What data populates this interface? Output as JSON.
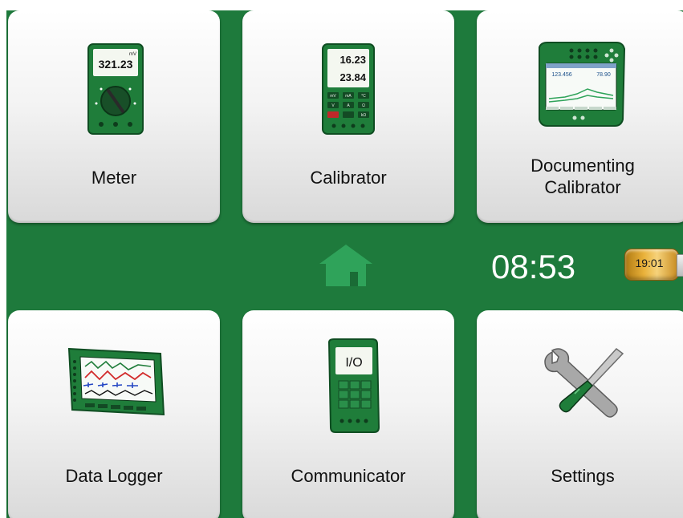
{
  "tiles": {
    "meter": {
      "label": "Meter",
      "display_value": "321.23",
      "display_unit": "mV"
    },
    "calibrator": {
      "label": "Calibrator",
      "display_top": "16.23",
      "display_bottom": "23.84",
      "unit_top": "mV",
      "unit_bottom": "mA",
      "keys": [
        "mV",
        "mA",
        "°C",
        "V",
        "A",
        "Ω",
        "kΩ"
      ]
    },
    "documenting_calibrator": {
      "label": "Documenting\nCalibrator",
      "value_left": "123.456",
      "value_right": "78.90"
    },
    "data_logger": {
      "label": "Data Logger"
    },
    "communicator": {
      "label": "Communicator",
      "screen_text": "I/O"
    },
    "settings": {
      "label": "Settings"
    }
  },
  "status_bar": {
    "clock": "08:53",
    "battery_time": "19:01",
    "home_icon": "home-icon"
  },
  "colors": {
    "background": "#1e7a3c",
    "home_icon": "#2fa35a",
    "battery": "#e9b13a"
  }
}
